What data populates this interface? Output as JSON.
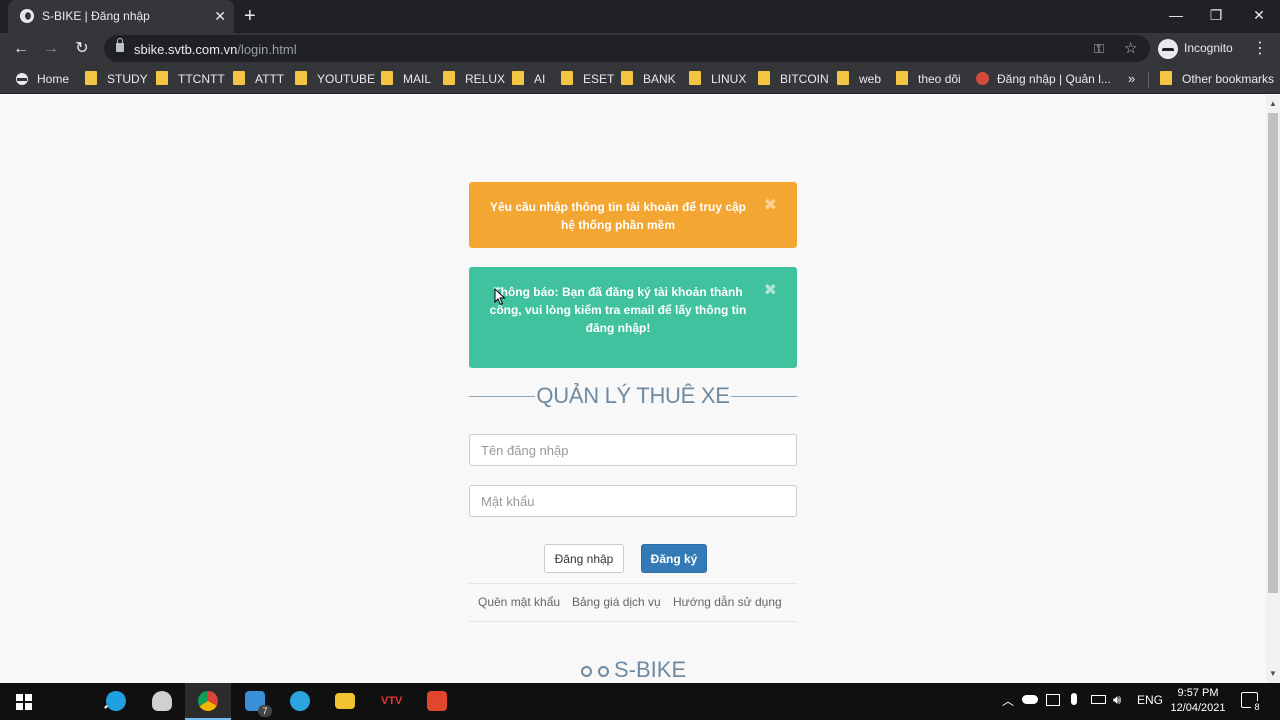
{
  "browser": {
    "tab_title": "S-BIKE | Đăng nhập",
    "tab_close": "✕",
    "new_tab": "+",
    "url_host": "sbike.svtb.com.vn",
    "url_path": "/login.html",
    "profile_label": "Incognito",
    "window_min": "—",
    "window_restore": "❐",
    "window_close": "✕",
    "back": "←",
    "forward": "→",
    "reload": "↻",
    "key": "⚿",
    "star": "☆",
    "menu": "⋮",
    "bookmarks": [
      {
        "label": "Home",
        "icon": "ninja-icon"
      },
      {
        "label": "STUDY",
        "icon": "folder-icon"
      },
      {
        "label": "TTCNTT",
        "icon": "folder-icon"
      },
      {
        "label": "ATTT",
        "icon": "folder-icon"
      },
      {
        "label": "YOUTUBE",
        "icon": "folder-icon"
      },
      {
        "label": "MAIL",
        "icon": "folder-icon"
      },
      {
        "label": "RELUX",
        "icon": "folder-icon"
      },
      {
        "label": "AI",
        "icon": "folder-icon"
      },
      {
        "label": "ESET",
        "icon": "folder-icon"
      },
      {
        "label": "BANK",
        "icon": "folder-icon"
      },
      {
        "label": "LINUX",
        "icon": "folder-icon"
      },
      {
        "label": "BITCOIN",
        "icon": "folder-icon"
      },
      {
        "label": "web",
        "icon": "folder-icon"
      },
      {
        "label": "theo dõi",
        "icon": "folder-icon"
      },
      {
        "label": "Đăng nhập | Quản l...",
        "icon": "site-icon"
      }
    ],
    "bookmarks_overflow": "»",
    "other_bookmarks": "Other bookmarks"
  },
  "page": {
    "alert_warning": "Yêu cầu nhập thông tin tài khoản để truy cập hệ thống phần mềm",
    "alert_success_bold": "Thông báo:",
    "alert_success_text": " Bạn đã đăng ký tài khoản thành công, vui lòng kiểm tra email để lấy thông tin đăng nhập!",
    "alert_close": "✖",
    "heading": "QUẢN LÝ THUÊ XE",
    "username_placeholder": "Tên đăng nhập",
    "password_placeholder": "Mật khẩu",
    "login_button": "Đăng nhập",
    "register_button": "Đăng ký",
    "links": [
      "Quên mật khẩu",
      "Bảng giá dịch vụ",
      "Hướng dẫn sử dụng"
    ],
    "brand": "S-BIKE"
  },
  "taskbar": {
    "taskview_badge": "7",
    "lang": "ENG",
    "time": "9:57 PM",
    "date": "12/04/2021",
    "notification_count": "8",
    "tray_up": "︿",
    "colors": {
      "edge": "#1fa0e0",
      "chrome": "#db4437",
      "telegram": "#2aa3df",
      "explorer": "#f1c232",
      "app_red": "#e0452d"
    }
  }
}
